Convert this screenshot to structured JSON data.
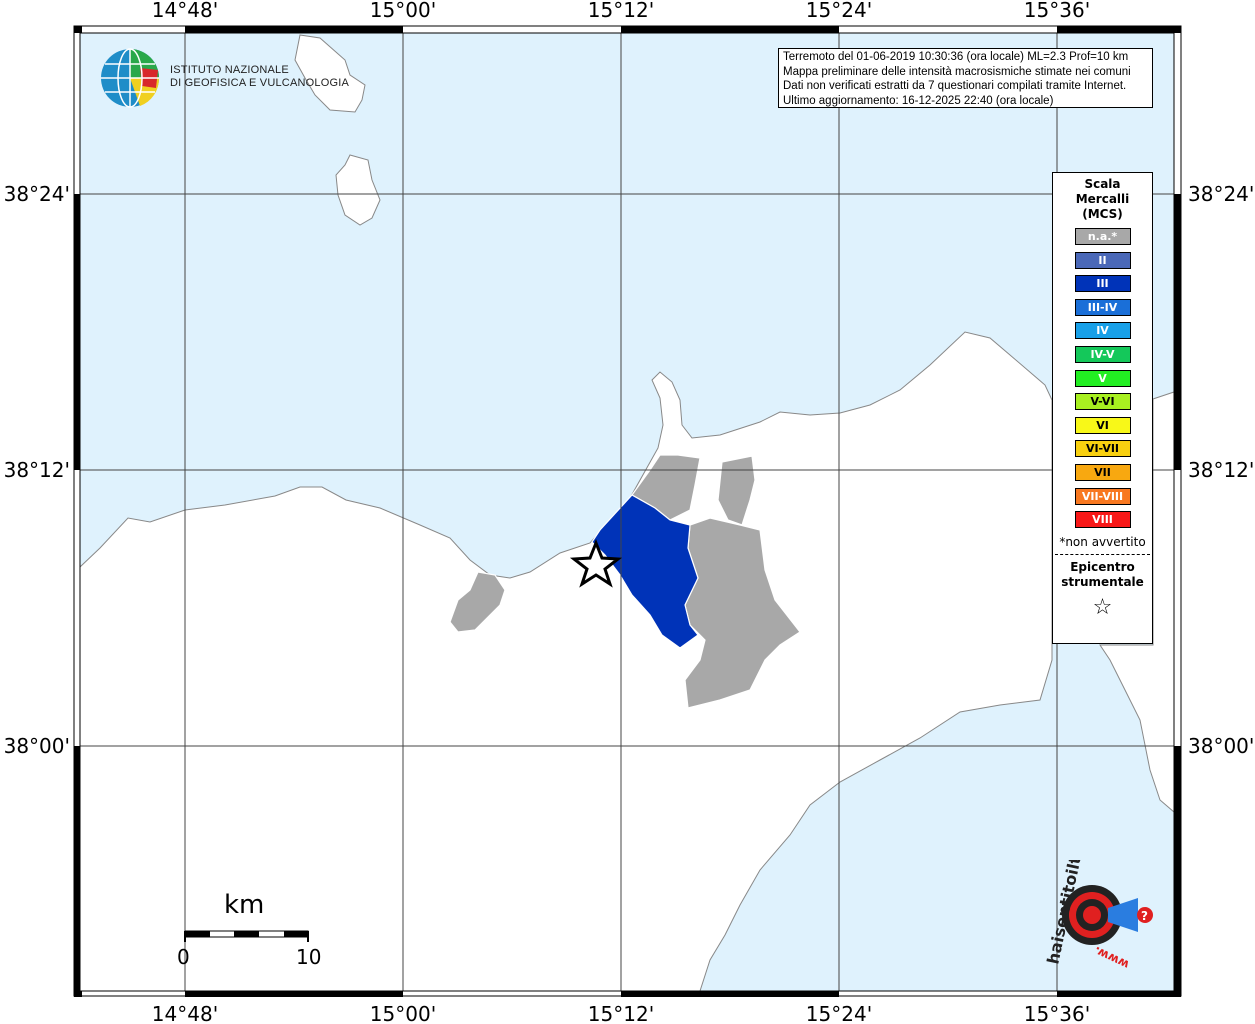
{
  "map": {
    "lon_ticks": [
      "14°48'",
      "15°00'",
      "15°12'",
      "15°24'",
      "15°36'"
    ],
    "lat_ticks": [
      "38°24'",
      "38°12'",
      "38°00'"
    ],
    "colors": {
      "sea": "#dff2fd",
      "land": "#ffffff",
      "na": "#a8a8a8",
      "iii": "#0033b8"
    }
  },
  "info": {
    "line1": "Terremoto del 01-06-2019 10:30:36 (ora locale) ML=2.3 Prof=10 km",
    "line2": "Mappa preliminare delle intensità macrosismiche stimate nei comuni",
    "line3": "Dati non verificati estratti da 7 questionari compilati tramite Internet.",
    "line4": "Ultimo aggiornamento: 16-12-2025 22:40 (ora locale)"
  },
  "logo": {
    "line1": "ISTITUTO NAZIONALE",
    "line2": "DI GEOFISICA E VULCANOLOGIA"
  },
  "legend": {
    "title": "Scala\nMercalli\n(MCS)",
    "items": [
      {
        "label": "n.a.*",
        "color": "#a8a8a8"
      },
      {
        "label": "II",
        "color": "#4a68b8"
      },
      {
        "label": "III",
        "color": "#0033b8"
      },
      {
        "label": "III-IV",
        "color": "#1a6fd8"
      },
      {
        "label": "IV",
        "color": "#18a0e8"
      },
      {
        "label": "IV-V",
        "color": "#14c85a"
      },
      {
        "label": "V",
        "color": "#22ee22"
      },
      {
        "label": "V-VI",
        "color": "#a8f020"
      },
      {
        "label": "VI",
        "color": "#f8f818"
      },
      {
        "label": "VI-VII",
        "color": "#f8d010"
      },
      {
        "label": "VII",
        "color": "#f8a810"
      },
      {
        "label": "VII-VIII",
        "color": "#f87820"
      },
      {
        "label": "VIII",
        "color": "#f81818"
      }
    ],
    "note": "*non avvertito",
    "epicenter": "Epicentro\nstrumentale",
    "star": "☆"
  },
  "scalebar": {
    "title": "km",
    "zero": "0",
    "ten": "10"
  },
  "hsi": {
    "text": "haisentitoilterremoto.it",
    "url": "www.",
    "q": "?"
  }
}
